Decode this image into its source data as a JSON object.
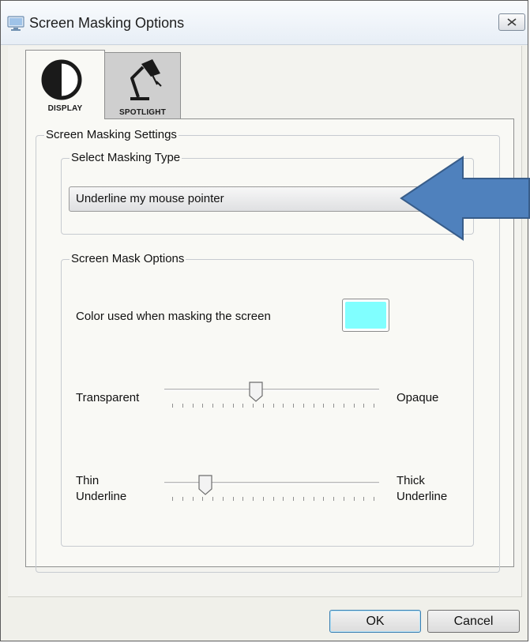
{
  "window": {
    "title": "Screen Masking Options",
    "close_icon": "close-icon"
  },
  "tabs": [
    {
      "label": "DISPLAY",
      "icon": "display-half-circle-icon",
      "active": true
    },
    {
      "label": "SPOTLIGHT",
      "icon": "desk-lamp-icon",
      "active": false
    }
  ],
  "settings": {
    "group_label": "Screen Masking Settings",
    "masking_type": {
      "group_label": "Select Masking Type",
      "selected": "Underline my mouse pointer"
    },
    "mask_options": {
      "group_label": "Screen Mask Options",
      "color_label": "Color used when masking the screen",
      "color_value": "#80ffff",
      "opacity": {
        "min_label": "Transparent",
        "max_label": "Opaque",
        "value": 0.42,
        "tick_count": 21
      },
      "thickness": {
        "min_label_line1": "Thin",
        "min_label_line2": "Underline",
        "max_label_line1": "Thick",
        "max_label_line2": "Underline",
        "value": 0.17,
        "tick_count": 21
      }
    }
  },
  "annotation": {
    "arrow_color": "#4f81bd",
    "arrow_icon": "left-arrow-callout-icon"
  },
  "buttons": {
    "ok": "OK",
    "cancel": "Cancel"
  }
}
